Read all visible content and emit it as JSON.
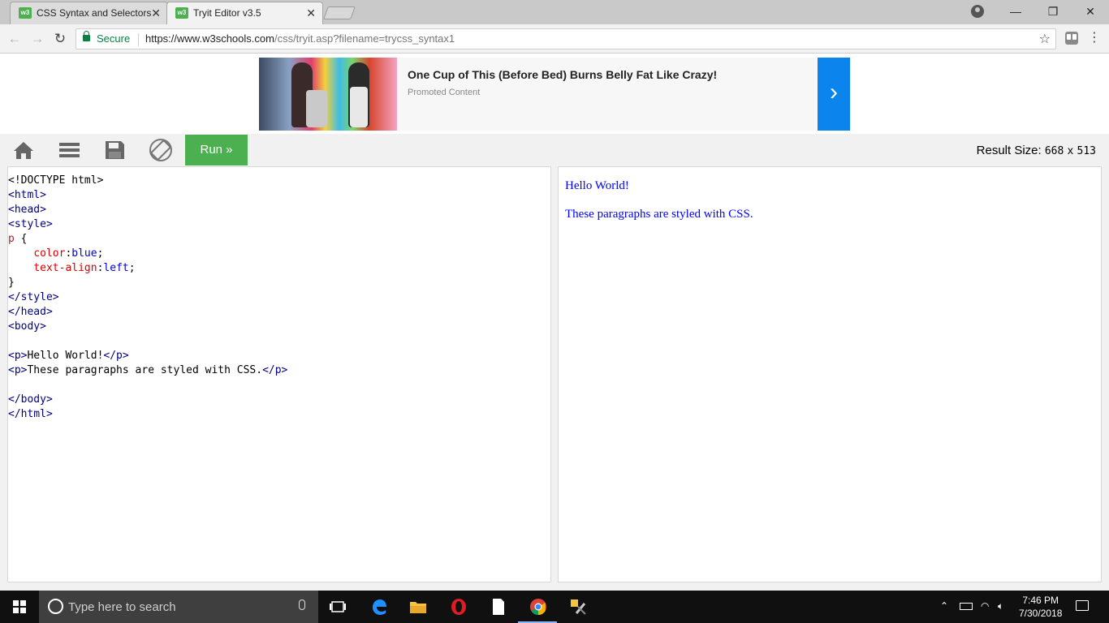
{
  "browser": {
    "tabs": [
      {
        "favicon": "w3",
        "title": "CSS Syntax and Selectors",
        "close": "✕"
      },
      {
        "favicon": "w3",
        "title": "Tryit Editor v3.5",
        "close": "✕"
      }
    ],
    "window": {
      "minimize": "—",
      "restore": "❐",
      "close": "✕"
    },
    "secure_label": "Secure",
    "url_main": "https://www.w3schools.com",
    "url_rest": "/css/tryit.asp?filename=trycss_syntax1",
    "icons": [
      "back-arrow-icon",
      "forward-arrow-icon",
      "reload-icon",
      "lock-icon",
      "star-icon",
      "extension-icon",
      "menu-dots-icon"
    ]
  },
  "ad": {
    "title": "One Cup of This (Before Bed) Burns Belly Fat Like Crazy!",
    "subtitle": "Promoted Content",
    "arrow": "›"
  },
  "tryit": {
    "run_label": "Run »",
    "result_size_label": "Result Size:",
    "result_width": "668",
    "result_x": "x",
    "result_height": "513",
    "icons": [
      "home-icon",
      "menu-icon",
      "save-icon",
      "rotate-icon"
    ]
  },
  "code": {
    "doctype": "<!DOCTYPE html>",
    "html_open": "<html>",
    "head_open": "<head>",
    "style_open": "<style>",
    "selector": "p",
    "brace_open": " {",
    "prop1": "color",
    "val1": "blue",
    "prop2": "text-align",
    "val2": "left",
    "brace_close": "}",
    "style_close": "</style>",
    "head_close": "</head>",
    "body_open": "<body>",
    "p_open": "<p>",
    "p_close": "</p>",
    "p1_text": "Hello World!",
    "p2_text": "These paragraphs are styled with CSS.",
    "body_close": "</body>",
    "html_close": "</html>"
  },
  "result": {
    "p1": "Hello World!",
    "p2": "These paragraphs are styled with CSS."
  },
  "taskbar": {
    "search_placeholder": "Type here to search",
    "time": "7:46 PM",
    "date": "7/30/2018",
    "apps": [
      "task-view-icon",
      "edge-icon",
      "file-explorer-icon",
      "opera-icon",
      "notepad-icon",
      "chrome-icon",
      "tools-icon"
    ]
  }
}
